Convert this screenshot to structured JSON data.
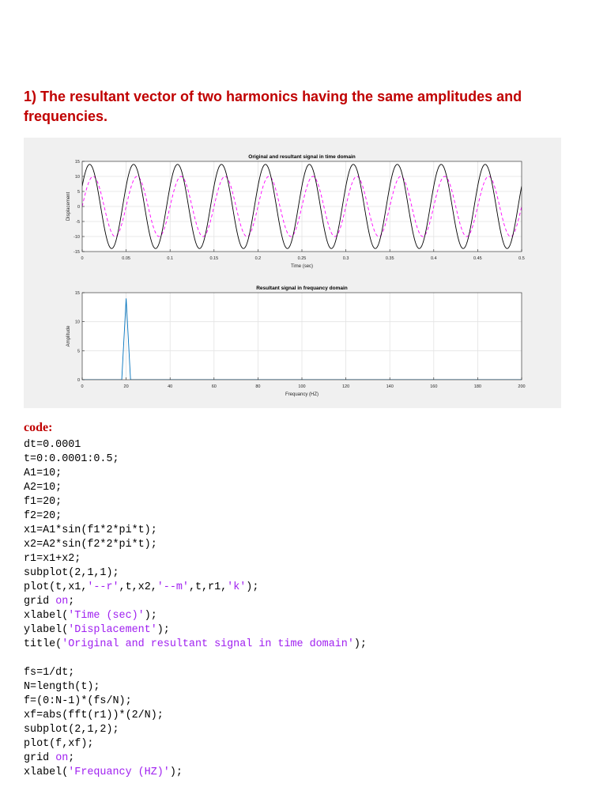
{
  "heading": "1) The resultant vector of two harmonics having the same amplitudes and frequencies.",
  "code_label": "code:",
  "code_lines": [
    [
      {
        "t": "dt=0.0001"
      }
    ],
    [
      {
        "t": "t=0:0.0001:0.5;"
      }
    ],
    [
      {
        "t": "A1=10;"
      }
    ],
    [
      {
        "t": "A2=10;"
      }
    ],
    [
      {
        "t": "f1=20;"
      }
    ],
    [
      {
        "t": "f2=20;"
      }
    ],
    [
      {
        "t": "x1=A1*sin(f1*2*pi*t);"
      }
    ],
    [
      {
        "t": "x2=A2*sin(f2*2*pi*t);"
      }
    ],
    [
      {
        "t": "r1=x1+x2;"
      }
    ],
    [
      {
        "t": "subplot(2,1,1);"
      }
    ],
    [
      {
        "t": "plot(t,x1,"
      },
      {
        "t": "'--r'",
        "c": "s"
      },
      {
        "t": ",t,x2,"
      },
      {
        "t": "'--m'",
        "c": "s"
      },
      {
        "t": ",t,r1,"
      },
      {
        "t": "'k'",
        "c": "s"
      },
      {
        "t": ");"
      }
    ],
    [
      {
        "t": "grid "
      },
      {
        "t": "on",
        "c": "k"
      },
      {
        "t": ";"
      }
    ],
    [
      {
        "t": "xlabel("
      },
      {
        "t": "'Time (sec)'",
        "c": "s"
      },
      {
        "t": ");"
      }
    ],
    [
      {
        "t": "ylabel("
      },
      {
        "t": "'Displacement'",
        "c": "s"
      },
      {
        "t": ");"
      }
    ],
    [
      {
        "t": "title("
      },
      {
        "t": "'Original and resultant signal in time domain'",
        "c": "s"
      },
      {
        "t": ");"
      }
    ],
    [
      {
        "t": ""
      }
    ],
    [
      {
        "t": "fs=1/dt;"
      }
    ],
    [
      {
        "t": "N=length(t);"
      }
    ],
    [
      {
        "t": "f=(0:N-1)*(fs/N);"
      }
    ],
    [
      {
        "t": "xf=abs(fft(r1))*(2/N);"
      }
    ],
    [
      {
        "t": "subplot(2,1,2);"
      }
    ],
    [
      {
        "t": "plot(f,xf);"
      }
    ],
    [
      {
        "t": "grid "
      },
      {
        "t": "on",
        "c": "k"
      },
      {
        "t": ";"
      }
    ],
    [
      {
        "t": "xlabel("
      },
      {
        "t": "'Frequancy (HZ)'",
        "c": "s"
      },
      {
        "t": ");"
      }
    ]
  ],
  "chart_data": [
    {
      "type": "line",
      "title": "Original and resultant signal in time domain",
      "xlabel": "Time (sec)",
      "ylabel": "Displacement",
      "xlim": [
        0,
        0.5
      ],
      "ylim": [
        -15,
        15
      ],
      "xticks": [
        0,
        0.05,
        0.1,
        0.15,
        0.2,
        0.25,
        0.3,
        0.35,
        0.4,
        0.45,
        0.5
      ],
      "xtick_labels": [
        "0",
        "0.05",
        "0.1",
        "0.15",
        "0.2",
        "0.25",
        "0.3",
        "0.35",
        "0.4",
        "0.45",
        "0.5"
      ],
      "yticks": [
        -15,
        -10,
        -5,
        0,
        5,
        10,
        15
      ],
      "ytick_labels": [
        "-15",
        "-10",
        "-5",
        "0",
        "5",
        "10",
        "15"
      ],
      "grid": true,
      "series": [
        {
          "style": "dashed",
          "color": "#ff00ff",
          "amplitude": 10,
          "frequency_hz": 20
        },
        {
          "style": "solid",
          "color": "#000000",
          "amplitude": 14,
          "frequency_hz": 20,
          "phase_shift_sec": 0.004
        }
      ]
    },
    {
      "type": "line",
      "title": "Resultant signal in frequancy domain",
      "xlabel": "Frequancy (HZ)",
      "ylabel": "Amplitude",
      "xlim": [
        0,
        200
      ],
      "ylim": [
        0,
        15
      ],
      "xticks": [
        0,
        20,
        40,
        60,
        80,
        100,
        120,
        140,
        160,
        180,
        200
      ],
      "xtick_labels": [
        "0",
        "20",
        "40",
        "60",
        "80",
        "100",
        "120",
        "140",
        "160",
        "180",
        "200"
      ],
      "yticks": [
        0,
        5,
        10,
        15
      ],
      "ytick_labels": [
        "0",
        "5",
        "10",
        "15"
      ],
      "grid": true,
      "series": [
        {
          "color": "#0072bd",
          "x": [
            0,
            18,
            20,
            22,
            200
          ],
          "y": [
            0,
            0,
            14,
            0,
            0
          ]
        }
      ]
    }
  ]
}
